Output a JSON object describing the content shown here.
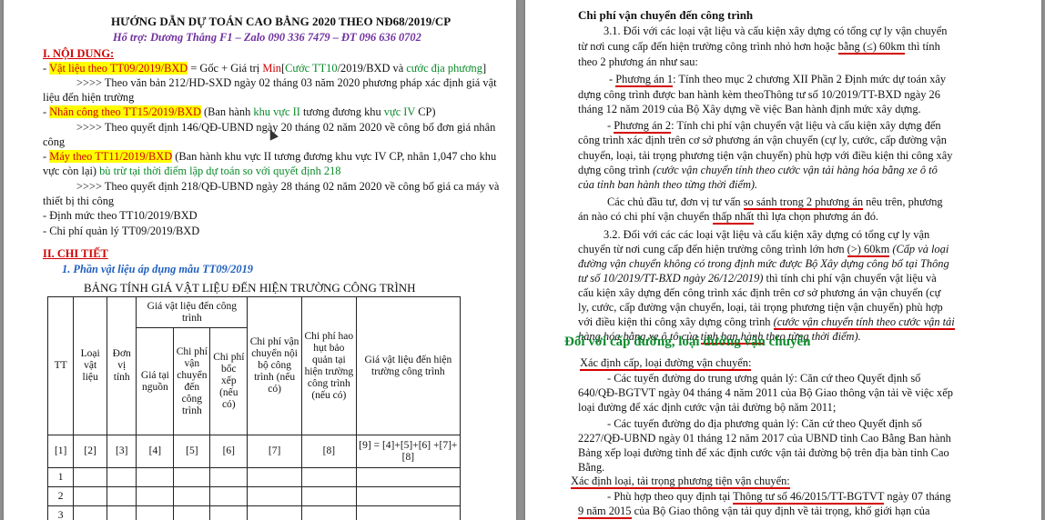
{
  "left": {
    "title": "HƯỚNG DẪN DỰ TOÁN CAO BẰNG 2020 THEO NĐ68/2019/CP",
    "support": "Hổ trợ: Dương Thắng F1 – Zalo 090 336 7479 – ĐT 096 636 0702",
    "section1": "I. NỘI DUNG:",
    "l1a": "- ",
    "l1b": "Vật liệu theo TT09/2019/BXD",
    "l1c": " = Gốc + Giá trị ",
    "l1d": "Min",
    "l1e": "[",
    "l1f": "Cước TT10",
    "l1g": "/2019/BXD và ",
    "l1h": "cước địa phương",
    "l1i": "]",
    "l2": ">>>> Theo văn bản 212/HD-SXD ngày 02 tháng 03 năm 2020 phương pháp xác định giá vật",
    "l3": "liệu đến hiện trường",
    "l4a": "- ",
    "l4b": "Nhân công theo TT15/2019/BXD",
    "l4c": " (Ban hành ",
    "l4d": "khu vực II",
    "l4e": " tương đương khu ",
    "l4f": "vực IV",
    "l4g": " CP)",
    "l5": ">>>> Theo quyết định 146/QĐ-UBND ngày 20 tháng 02 năm 2020 về công bố đơn giá nhân",
    "l6": "công",
    "l7a": "- ",
    "l7b": "Máy theo TT11/2019/BXD",
    "l7c": " (Ban hành khu vực II tương đương khu vực IV CP, nhân 1,047 cho khu",
    "l8a": "vực còn lại) ",
    "l8b": "bù trừ tại thời điểm lập dự toán so với quyết định 218",
    "l9": ">>>> Theo quyết định 218/QĐ-UBND ngày 28 tháng 02 năm 2020 về công bố giá ca máy và",
    "l10": "thiết bị thi công",
    "l11": "- Định mức theo TT10/2019/BXD",
    "l12": "- Chi phí quản lý TT09/2019/BXD",
    "section2": "II. CHI TIẾT",
    "sub1": "1.   Phần vật liệu áp dụng mẫu TT09/2019",
    "table_title": "BẢNG TÍNH GIÁ VẬT LIỆU ĐẾN HIỆN TRƯỜNG CÔNG TRÌNH",
    "table": {
      "h_tt": "TT",
      "h_loai": "Loại vật liệu",
      "h_donvi": "Đơn vị tính",
      "h_group": "Giá vật liệu đến công trình",
      "h_gia": "Giá tại nguồn",
      "h_chiphi_vc": "Chi phí vận chuyển đến công trình",
      "h_bocxep": "Chi phí bốc xếp (nếu có)",
      "h_noibo": "Chi phí vận chuyển nội bộ công trình (nếu có)",
      "h_haohut": "Chi phí hao hụt bảo quản tại hiện trường công trình (nếu có)",
      "h_hientruong": "Giá vật liệu đến hiện trường công trình",
      "idx": [
        "[1]",
        "[2]",
        "[3]",
        "[4]",
        "[5]",
        "[6]",
        "[7]",
        "[8]",
        "[9] = [4]+[5]+[6] +[7]+[8]"
      ],
      "rows": [
        "1",
        "2",
        "3"
      ]
    }
  },
  "right": {
    "heading": "Chi phí vận chuyển đến công trình",
    "p1a": "3.1. Đối với các loại vật liệu và cấu kiện xây dựng có tổng cự ly vận chuyển",
    "p1b": "từ nơi cung cấp đến hiện trường công trình nhỏ hơn hoặc ",
    "p1c": "bằng (≤) 60km",
    "p1d": " thì tính",
    "p1e": "theo 2 phương án như sau:",
    "pa1a": "- ",
    "pa1b": "Phương án 1",
    "pa1c": ": Tính theo mục 2 chương XII Phần 2  Định mức dự toán xây",
    "pa1d": "dựng công trình được ban hành kèm theoThông tư số 10/2019/TT-BXD ngày 26",
    "pa1e": "tháng 12 năm 2019 của Bộ Xây dựng về việc Ban hành định mức xây dựng.",
    "pa2a": "- ",
    "pa2b": "Phương án 2",
    "pa2c": ": Tính chi phí vận chuyển vật liệu và cấu kiện xây dựng đến",
    "pa2d": "công trình xác định trên cơ sở phương án vận chuyển (cự ly, cước, cấp đường vận",
    "pa2e": "chuyển, loại, tải trọng phương tiện vận chuyển) phù hợp với điều kiện thi công xây",
    "pa2f": "dựng công trình ",
    "pa2g": "(cước vận chuyển tính theo cước vận tải hàng hóa bằng xe ô tô",
    "pa2h": "của tỉnh ban hành theo từng thời điểm).",
    "p2a": "Các chủ đầu tư, đơn vị tư vấn ",
    "p2b": "so sánh trong 2 phương án",
    "p2c": " nêu trên, phương",
    "p2d": "án nào có chi phí vận chuyển ",
    "p2e": "thấp nhất",
    "p2f": " thì lựa chọn phương án đó.",
    "p3a": "3.2. Đối với các các loại vật liệu và cấu kiện xây dựng có tổng cự ly vận",
    "p3b": "chuyển từ nơi cung cấp đến hiện trường công trình lớn hơn ",
    "p3c": "(>) 60km",
    "p3d": " (Cấp và loại",
    "p3e": "đường vận chuyển không có trong định mức được Bộ Xây dựng công bố tại Thông",
    "p3f": "tư số 10/2019/TT-BXD ngày 26/12/2019)",
    "p3g": " thì tính chi phí vận chuyển vật liệu và",
    "p3h": "cấu kiện xây dựng đến công trình xác định trên cơ sở phương án vận chuyển (cự",
    "p3i": "ly, cước, cấp đường vận chuyển, loại, tải trọng phương tiện vận chuyển) phù hợp",
    "p3j": "với điều kiện thi công xây dựng công trình ",
    "p3k": "(cước vận chuyển tính theo cước vận tải",
    "p3l": "hàng hóa bằng xe ô tô của ",
    "p3m": "tỉnh ban hành",
    "p3n": " theo từng thời điểm).",
    "green": "Đối với cấp đường, loại đường vận chuyển",
    "s1": "Xác định cấp, loại đường vận chuyển:",
    "q1a": "- Các tuyến đường do trung ương quản lý: Căn cứ theo Quyết định số",
    "q1b": "640/QĐ-BGTVT ngày 04 tháng 4 năm 2011 của Bộ Giao thông vận tải về việc xếp",
    "q1c": "loại đường để xác định cước vận tải đường bộ năm 2011;",
    "q2a": "- Các tuyến đường do địa phương quản lý: Căn cứ theo Quyết định số",
    "q2b": "2227/QĐ-UBND ngày 01 tháng 12 năm 2017 của UBND tỉnh Cao Bằng Ban hành",
    "q2c": "Bảng xếp loại đường tỉnh để xác định cước vận tải đường bộ trên địa bàn tỉnh Cao",
    "q2d": "Bằng.",
    "s2": "Xác định loại, tải trọng phương tiện vận chuyển:",
    "r1a": "- Phù hợp theo quy định tại ",
    "r1b": "Thông tư số 46/2015/TT-BGTVT",
    "r1c": " ngày 07 tháng",
    "r1d": "9 năm 2015",
    "r1e": " của Bộ Giao thông vận tải quy định về tải trọng, khổ giới hạn của"
  }
}
